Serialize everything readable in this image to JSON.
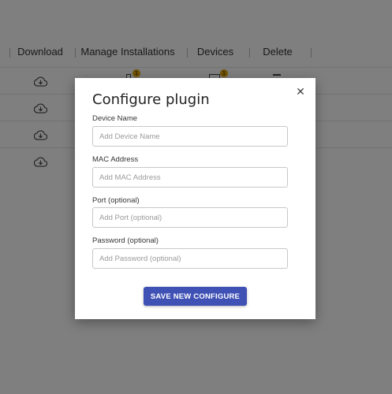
{
  "table": {
    "headers": [
      "Download",
      "Manage Installations",
      "Devices",
      "Delete"
    ],
    "row_count": 4,
    "badges": [
      "1",
      "1"
    ]
  },
  "modal": {
    "title": "Configure plugin",
    "close_icon": "close-icon",
    "fields": [
      {
        "label": "Device Name",
        "placeholder": "Add Device Name",
        "value": ""
      },
      {
        "label": "MAC Address",
        "placeholder": "Add MAC Address",
        "value": ""
      },
      {
        "label": "Port (optional)",
        "placeholder": "Add Port (optional)",
        "value": ""
      },
      {
        "label": "Password (optional)",
        "placeholder": "Add Password (optional)",
        "value": ""
      }
    ],
    "submit_label": "SAVE NEW CONFIGURE"
  },
  "colors": {
    "primary_button": "#3f51b5",
    "badge": "#e6a800",
    "overlay": "rgba(0,0,0,0.5)"
  }
}
